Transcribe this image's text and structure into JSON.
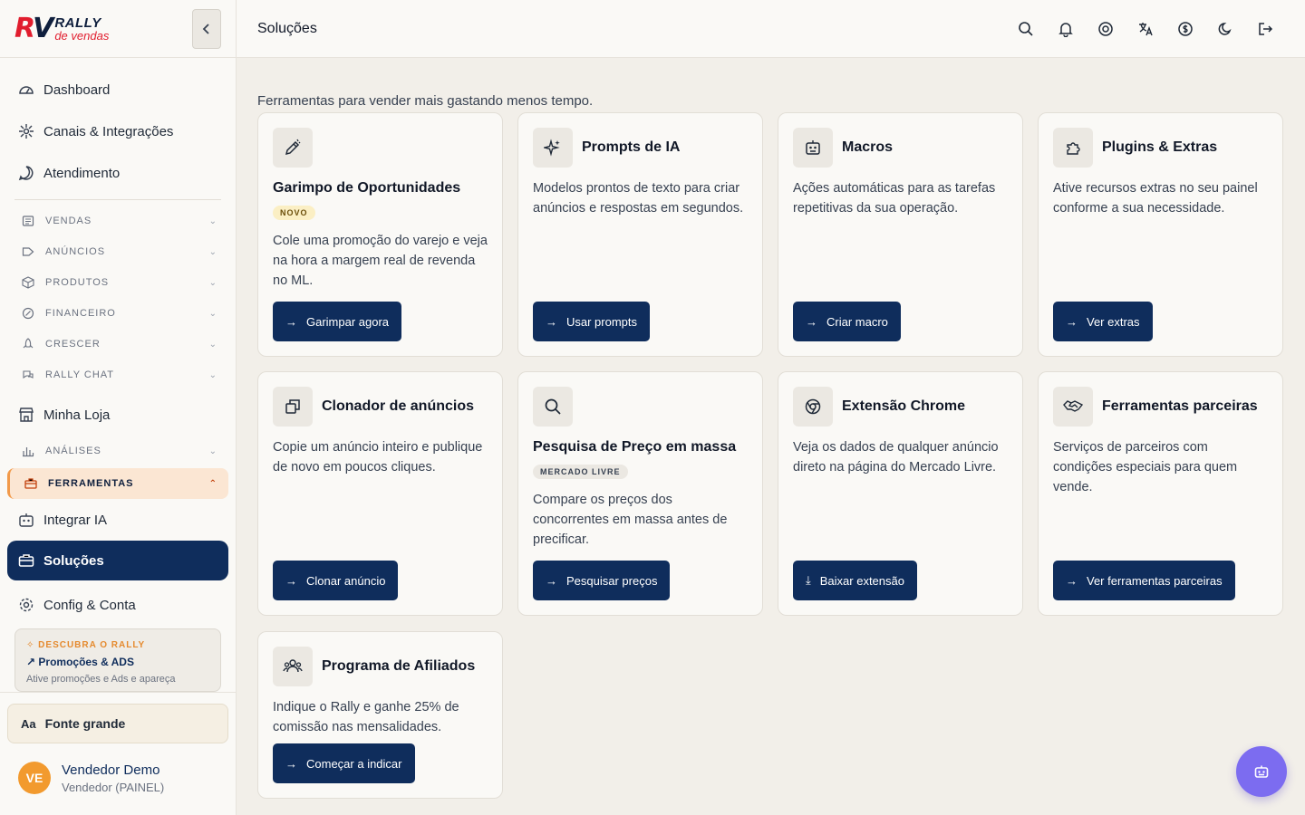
{
  "brand": {
    "mark_left": "R",
    "mark_right": "V",
    "line1": "RALLY",
    "line2": "de vendas"
  },
  "sidebar": {
    "primary": [
      {
        "label": "Dashboard",
        "icon": "gauge-icon"
      },
      {
        "label": "Canais & Integrações",
        "icon": "network-icon"
      },
      {
        "label": "Atendimento",
        "icon": "chat-icon"
      }
    ],
    "sections": [
      {
        "label": "VENDAS",
        "icon": "list-icon"
      },
      {
        "label": "ANÚNCIOS",
        "icon": "tag-icon"
      },
      {
        "label": "PRODUTOS",
        "icon": "box-icon"
      },
      {
        "label": "FINANCEIRO",
        "icon": "money-icon"
      },
      {
        "label": "CRESCER",
        "icon": "rocket-icon"
      },
      {
        "label": "RALLY CHAT",
        "icon": "chat-bubbles-icon"
      }
    ],
    "minha_loja": "Minha Loja",
    "analises": "ANÁLISES",
    "ferramentas": "FERRAMENTAS",
    "integrar_ia": "Integrar IA",
    "solucoes": "Soluções",
    "config": "Config & Conta",
    "promo": {
      "tag": "DESCUBRA O RALLY",
      "title": "Promoções & ADS",
      "desc": "Ative promoções e Ads e apareça"
    },
    "font_button": {
      "glyph": "Aa",
      "label": "Fonte grande"
    },
    "user": {
      "initials": "VE",
      "name": "Vendedor Demo",
      "role": "Vendedor (PAINEL)"
    }
  },
  "header": {
    "title": "Soluções",
    "icons": [
      "search-icon",
      "bell-icon",
      "help-icon",
      "translate-icon",
      "currency-icon",
      "moon-icon",
      "logout-icon"
    ]
  },
  "main": {
    "subtitle": "Ferramentas para vender mais gastando menos tempo.",
    "cards": [
      {
        "title": "Garimpo de Oportunidades",
        "badge": "NOVO",
        "desc": "Cole uma promoção do varejo e veja na hora a margem real de revenda no ML.",
        "button": "Garimpar agora",
        "icon": "edit-icon"
      },
      {
        "title": "Prompts de IA",
        "desc": "Modelos prontos de texto para criar anúncios e respostas em segundos.",
        "button": "Usar prompts",
        "icon": "sparkles-icon"
      },
      {
        "title": "Macros",
        "desc": "Ações automáticas para as tarefas repetitivas da sua operação.",
        "button": "Criar macro",
        "icon": "robot-icon"
      },
      {
        "title": "Plugins & Extras",
        "desc": "Ative recursos extras no seu painel conforme a sua necessidade.",
        "button": "Ver extras",
        "icon": "puzzle-icon"
      },
      {
        "title": "Clonador de anúncios",
        "desc": "Copie um anúncio inteiro e publique de novo em poucos cliques.",
        "button": "Clonar anúncio",
        "icon": "copy-icon"
      },
      {
        "title": "Pesquisa de Preço em massa",
        "badge": "MERCADO LIVRE",
        "desc": "Compare os preços dos concorrentes em massa antes de precificar.",
        "button": "Pesquisar preços",
        "icon": "search-icon"
      },
      {
        "title": "Extensão Chrome",
        "desc": "Veja os dados de qualquer anúncio direto na página do Mercado Livre.",
        "button": "Baixar extensão",
        "icon": "chrome-icon"
      },
      {
        "title": "Ferramentas parceiras",
        "desc": "Serviços de parceiros com condições especiais para quem vende.",
        "button": "Ver ferramentas parceiras",
        "icon": "handshake-icon"
      },
      {
        "title": "Programa de Afiliados",
        "desc": "Indique o Rally e ganhe 25% de comissão nas mensalidades.",
        "button": "Começar a indicar",
        "icon": "users-icon"
      }
    ]
  },
  "colors": {
    "navy": "#0f2d5c",
    "accent": "#f29a4a",
    "fab": "#7c6cf0",
    "logo_red": "#e11d2e"
  }
}
